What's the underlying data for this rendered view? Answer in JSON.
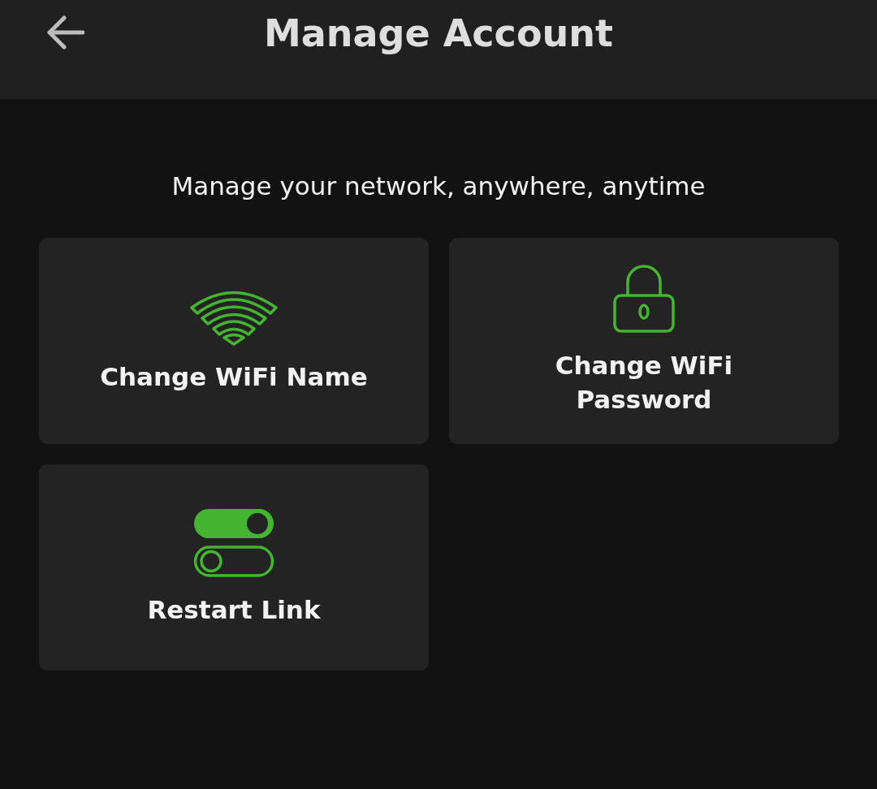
{
  "header": {
    "title": "Manage Account"
  },
  "subtitle": "Manage your network, anywhere, anytime",
  "tiles": [
    {
      "kind": "wifi",
      "label": "Change WiFi Name"
    },
    {
      "kind": "lock",
      "label": "Change WiFi Password"
    },
    {
      "kind": "toggle",
      "label": "Restart Link"
    }
  ]
}
